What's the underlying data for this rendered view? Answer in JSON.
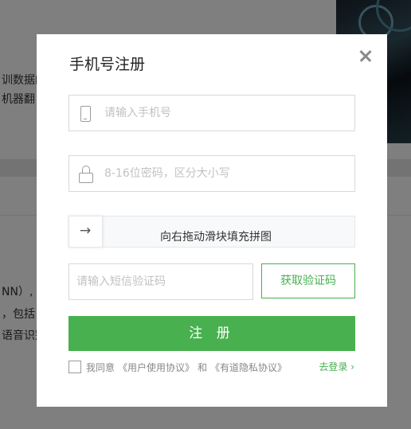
{
  "background": {
    "lines": [
      "训数据的",
      "机器翻",
      "NN）,",
      "，包括",
      "语音识别"
    ]
  },
  "modal": {
    "title": "手机号注册",
    "phone_placeholder": "请输入手机号",
    "password_placeholder": "8-16位密码，区分大小写",
    "slider_arrow": "→",
    "slider_text": "向右拖动滑块填充拼图",
    "sms_placeholder": "请输入短信验证码",
    "sms_button": "获取验证码",
    "register_button": "注 册",
    "agree_prefix": "我同意",
    "user_agreement": "《用户使用协议》",
    "agree_and": "和",
    "privacy_agreement": "《有道隐私协议》",
    "login_link": "去登录 ›"
  },
  "colors": {
    "accent": "#48b04f",
    "overlay": "rgba(0,0,0,0.5)"
  }
}
